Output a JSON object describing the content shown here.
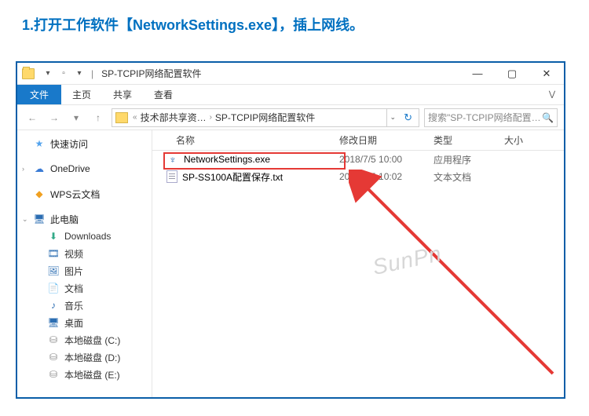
{
  "instruction": "1.打开工作软件【NetworkSettings.exe】，插上网线。",
  "window": {
    "title": "SP-TCPIP网络配置软件",
    "separator": "|"
  },
  "tabs": {
    "file": "文件",
    "home": "主页",
    "share": "共享",
    "view": "查看"
  },
  "breadcrumb": {
    "seg1": "技术部共享资…",
    "seg2": "SP-TCPIP网络配置软件"
  },
  "search": {
    "placeholder": "搜索\"SP-TCPIP网络配置软件\""
  },
  "columns": {
    "name": "名称",
    "date": "修改日期",
    "type": "类型",
    "size": "大小"
  },
  "sidebar": {
    "quick": "快速访问",
    "onedrive": "OneDrive",
    "wps": "WPS云文档",
    "pc": "此电脑",
    "downloads": "Downloads",
    "videos": "视频",
    "pictures": "图片",
    "docs": "文档",
    "music": "音乐",
    "desktop": "桌面",
    "drive_c": "本地磁盘 (C:)",
    "drive_d": "本地磁盘 (D:)",
    "drive_e": "本地磁盘 (E:)"
  },
  "files": [
    {
      "name": "NetworkSettings.exe",
      "date": "2018/7/5 10:00",
      "type": "应用程序"
    },
    {
      "name": "SP-SS100A配置保存.txt",
      "date": "2018/7/5 10:02",
      "type": "文本文档"
    }
  ],
  "watermark": "SunPn"
}
